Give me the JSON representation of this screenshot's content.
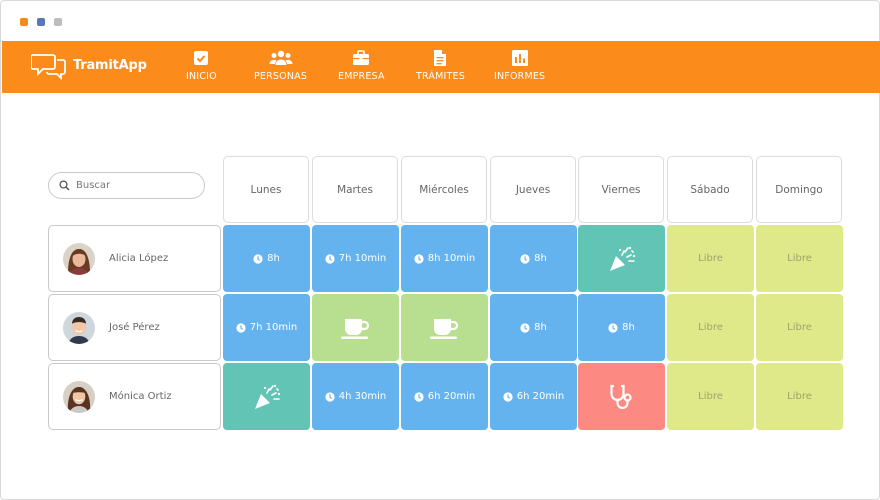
{
  "window": {
    "dot_colors": [
      "#f48a1c",
      "#5a78b8",
      "#bdbdbd"
    ]
  },
  "brand": {
    "name": "TramitApp"
  },
  "nav": [
    {
      "label": "INICIO",
      "icon": "check-square-icon"
    },
    {
      "label": "PERSONAS",
      "icon": "users-icon"
    },
    {
      "label": "EMPRESA",
      "icon": "briefcase-icon"
    },
    {
      "label": "TRÁMITES",
      "icon": "document-icon"
    },
    {
      "label": "INFORMES",
      "icon": "bar-chart-icon"
    }
  ],
  "search": {
    "placeholder": "Buscar"
  },
  "days": [
    "Lunes",
    "Martes",
    "Miércoles",
    "Jueves",
    "Viernes",
    "Sábado",
    "Domingo"
  ],
  "employees": [
    {
      "name": "Alicia López",
      "shifts": [
        {
          "type": "work",
          "text": "8h",
          "icon": "clock-icon",
          "color": "#65b3ee"
        },
        {
          "type": "work",
          "text": "7h 10min",
          "icon": "clock-icon",
          "color": "#65b3ee"
        },
        {
          "type": "work",
          "text": "8h 10min",
          "icon": "clock-icon",
          "color": "#65b3ee"
        },
        {
          "type": "work",
          "text": "8h",
          "icon": "clock-icon",
          "color": "#65b3ee"
        },
        {
          "type": "holiday",
          "text": "",
          "icon": "party-popper-icon",
          "color": "#62c4b4"
        },
        {
          "type": "free",
          "text": "Libre",
          "icon": "",
          "color": "#e0e98a"
        },
        {
          "type": "free",
          "text": "Libre",
          "icon": "",
          "color": "#e0e98a"
        }
      ]
    },
    {
      "name": "José Pérez",
      "shifts": [
        {
          "type": "work",
          "text": "7h 10min",
          "icon": "clock-icon",
          "color": "#65b3ee"
        },
        {
          "type": "break",
          "text": "",
          "icon": "coffee-cup-icon",
          "color": "#b7df8f"
        },
        {
          "type": "break",
          "text": "",
          "icon": "coffee-cup-icon",
          "color": "#b7df8f"
        },
        {
          "type": "work",
          "text": "8h",
          "icon": "clock-icon",
          "color": "#65b3ee"
        },
        {
          "type": "work",
          "text": "8h",
          "icon": "clock-icon",
          "color": "#65b3ee"
        },
        {
          "type": "free",
          "text": "Libre",
          "icon": "",
          "color": "#e0e98a"
        },
        {
          "type": "free",
          "text": "Libre",
          "icon": "",
          "color": "#e0e98a"
        }
      ]
    },
    {
      "name": "Mónica Ortiz",
      "shifts": [
        {
          "type": "holiday",
          "text": "",
          "icon": "party-popper-icon",
          "color": "#62c4b4"
        },
        {
          "type": "work",
          "text": "4h 30min",
          "icon": "clock-icon",
          "color": "#65b3ee"
        },
        {
          "type": "work",
          "text": "6h 20min",
          "icon": "clock-icon",
          "color": "#65b3ee"
        },
        {
          "type": "work",
          "text": "6h 20min",
          "icon": "clock-icon",
          "color": "#65b3ee"
        },
        {
          "type": "sick",
          "text": "",
          "icon": "stethoscope-icon",
          "color": "#fd8a82"
        },
        {
          "type": "free",
          "text": "Libre",
          "icon": "",
          "color": "#e0e98a"
        },
        {
          "type": "free",
          "text": "Libre",
          "icon": "",
          "color": "#e0e98a"
        }
      ]
    }
  ]
}
